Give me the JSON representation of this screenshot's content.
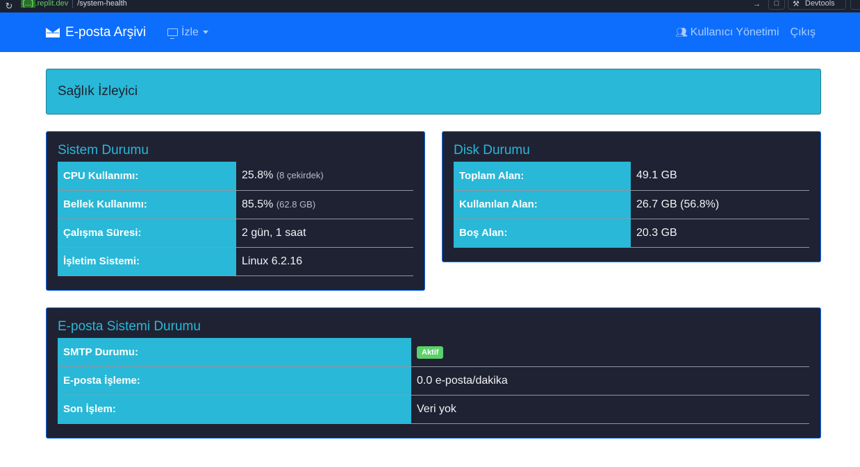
{
  "browser": {
    "domain_prefix": "{...}",
    "domain": ".replit.dev",
    "path": "/system-health",
    "devtools_label": "Devtools"
  },
  "navbar": {
    "brand": "E-posta Arşivi",
    "watch_menu": "İzle",
    "user_management": "Kullanıcı Yönetimi",
    "logout": "Çıkış"
  },
  "page": {
    "title": "Sağlık İzleyici"
  },
  "system_status": {
    "heading": "Sistem Durumu",
    "rows": [
      {
        "label": "CPU Kullanımı:",
        "value": "25.8%",
        "note": "(8 çekirdek)"
      },
      {
        "label": "Bellek Kullanımı:",
        "value": "85.5%",
        "note": "(62.8 GB)"
      },
      {
        "label": "Çalışma Süresi:",
        "value": "2 gün, 1 saat",
        "note": ""
      },
      {
        "label": "İşletim Sistemi:",
        "value": "Linux 6.2.16",
        "note": ""
      }
    ]
  },
  "disk_status": {
    "heading": "Disk Durumu",
    "rows": [
      {
        "label": "Toplam Alan:",
        "value": "49.1 GB"
      },
      {
        "label": "Kullanılan Alan:",
        "value": "26.7 GB (56.8%)"
      },
      {
        "label": "Boş Alan:",
        "value": "20.3 GB"
      }
    ]
  },
  "email_status": {
    "heading": "E-posta Sistemi Durumu",
    "smtp_label": "SMTP Durumu:",
    "smtp_badge": "Aktif",
    "smtp_badge_color": "#5bd16b",
    "processing_label": "E-posta İşleme:",
    "processing_value": "0.0 e-posta/dakika",
    "last_label": "Son İşlem:",
    "last_value": "Veri yok"
  },
  "colors": {
    "navbar": "#0d6efd",
    "accent": "#29b8d7",
    "card_bg": "#1f2233"
  }
}
